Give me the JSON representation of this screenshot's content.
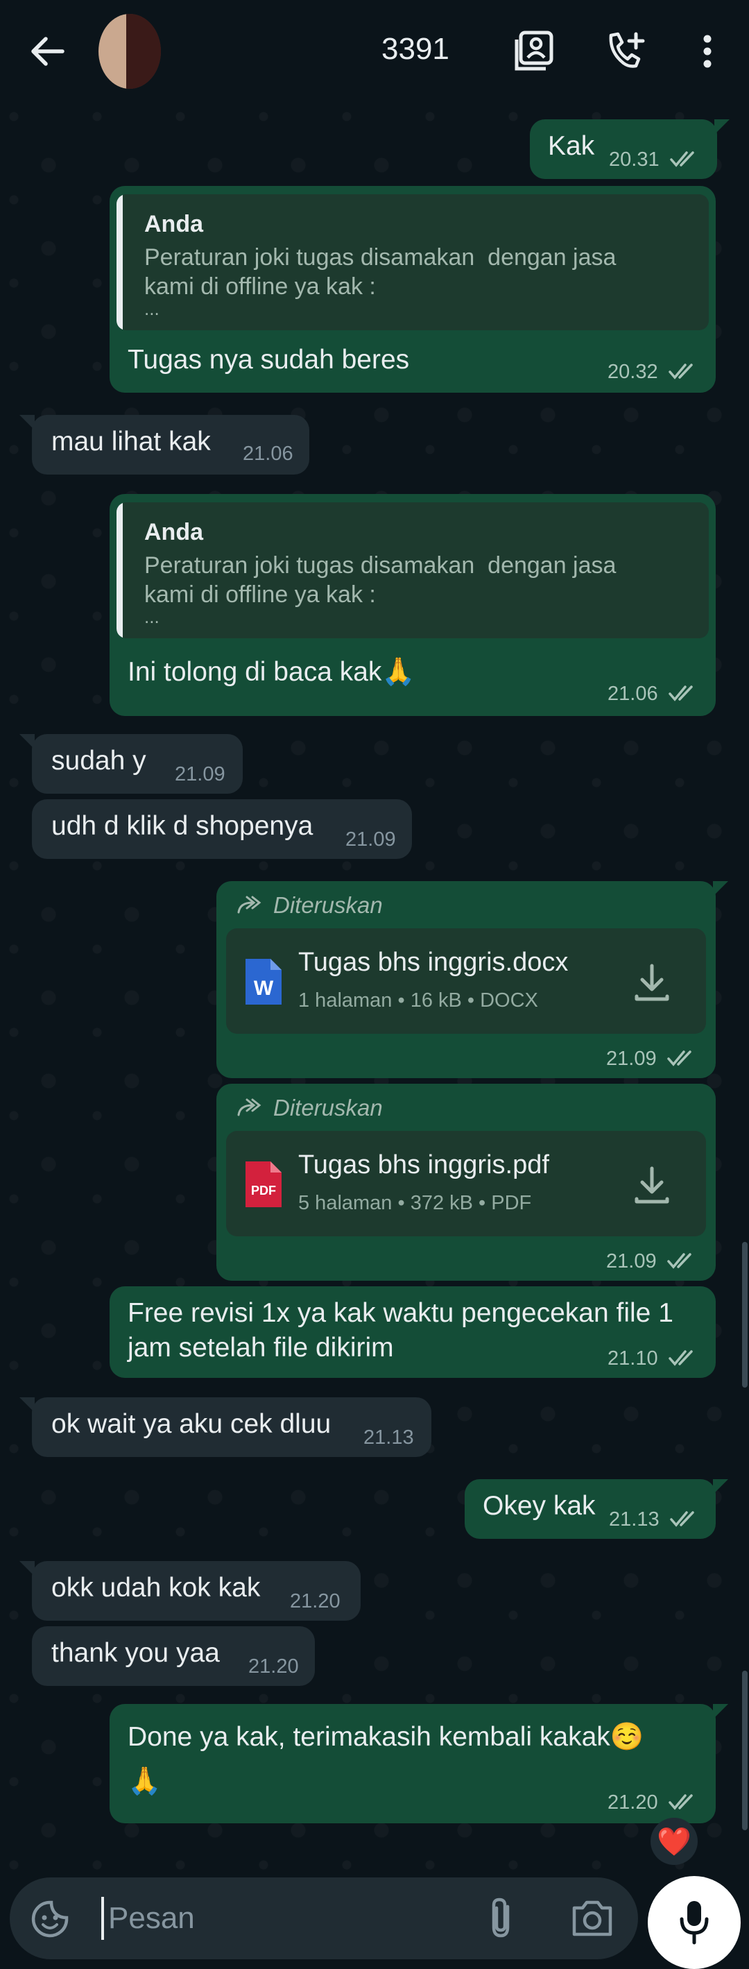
{
  "header": {
    "contact_name": "3391",
    "back_icon": "arrow-left-icon",
    "contact_icon": "contact-card-icon",
    "call_icon": "add-call-icon",
    "more_icon": "more-vert-icon"
  },
  "messages": [
    {
      "dir": "out",
      "text": "Kak",
      "time": "20.31"
    },
    {
      "dir": "out",
      "quote_name": "Anda",
      "quote_text": "Peraturan joki tugas disamakan  dengan jasa\nkami di offline ya kak :",
      "quote_more": "...",
      "text": "Tugas nya sudah beres",
      "time": "20.32"
    },
    {
      "dir": "in",
      "text": "mau lihat kak",
      "time": "21.06"
    },
    {
      "dir": "out",
      "quote_name": "Anda",
      "quote_text": "Peraturan joki tugas disamakan  dengan jasa\nkami di offline ya kak :",
      "quote_more": "...",
      "text": "Ini tolong di baca kak🙏",
      "time": "21.06"
    },
    {
      "dir": "in",
      "text": "sudah y",
      "time": "21.09"
    },
    {
      "dir": "in",
      "text": "udh d klik d shopenya",
      "time": "21.09"
    },
    {
      "dir": "out",
      "forwarded": "Diteruskan",
      "file_name": "Tugas bhs inggris.docx",
      "file_meta": "1 halaman • 16 kB • DOCX",
      "file_type": "word",
      "time": "21.09"
    },
    {
      "dir": "out",
      "forwarded": "Diteruskan",
      "file_name": "Tugas bhs inggris.pdf",
      "file_meta": "5 halaman • 372 kB • PDF",
      "file_type": "pdf",
      "file_badge": "PDF",
      "time": "21.09"
    },
    {
      "dir": "out",
      "text": "Free revisi 1x ya kak waktu pengecekan file 1\njam setelah file dikirim",
      "time": "21.10"
    },
    {
      "dir": "in",
      "text": "ok wait ya aku cek dluu",
      "time": "21.13"
    },
    {
      "dir": "out",
      "text": "Okey kak",
      "time": "21.13"
    },
    {
      "dir": "in",
      "text": "okk udah kok kak",
      "time": "21.20"
    },
    {
      "dir": "in",
      "text": "thank you yaa",
      "time": "21.20"
    },
    {
      "dir": "out",
      "text": "Done ya kak, terimakasih kembali kakak☺️\n🙏",
      "time": "21.20",
      "reaction": "❤️"
    }
  ],
  "input": {
    "placeholder": "Pesan",
    "emoji_icon": "sticker-smile-icon",
    "attach_icon": "paperclip-icon",
    "camera_icon": "camera-icon",
    "mic_icon": "microphone-icon"
  },
  "colors": {
    "background": "#0b141a",
    "outgoing_bubble": "#144d37",
    "incoming_bubble": "#202c33",
    "quote_background": "#1d3a2e"
  }
}
